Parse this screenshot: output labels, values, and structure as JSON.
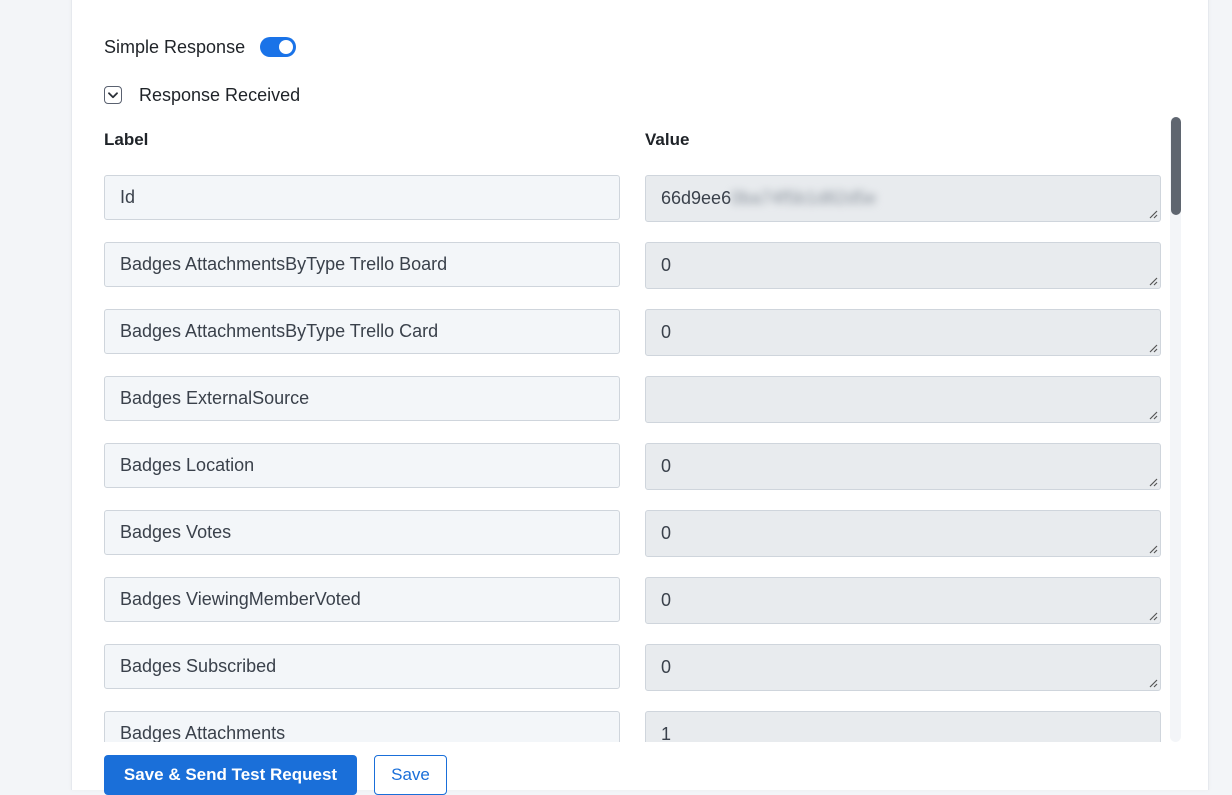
{
  "simple_response": {
    "label": "Simple Response",
    "enabled": true,
    "accent_color": "#1a73e8"
  },
  "response_received": {
    "label": "Response Received",
    "icon": "chevron-down-icon"
  },
  "columns": {
    "label": "Label",
    "value": "Value"
  },
  "rows": [
    {
      "label": "Id",
      "value": "66d9ee6",
      "value_redacted": "0ba74f5b1d82d5e"
    },
    {
      "label": "Badges AttachmentsByType Trello Board",
      "value": "0"
    },
    {
      "label": "Badges AttachmentsByType Trello Card",
      "value": "0"
    },
    {
      "label": "Badges ExternalSource",
      "value": ""
    },
    {
      "label": "Badges Location",
      "value": "0"
    },
    {
      "label": "Badges Votes",
      "value": "0"
    },
    {
      "label": "Badges ViewingMemberVoted",
      "value": "0"
    },
    {
      "label": "Badges Subscribed",
      "value": "0"
    },
    {
      "label": "Badges Attachments",
      "value": "1"
    }
  ],
  "buttons": {
    "primary": "Save & Send Test Request",
    "secondary": "Save"
  }
}
